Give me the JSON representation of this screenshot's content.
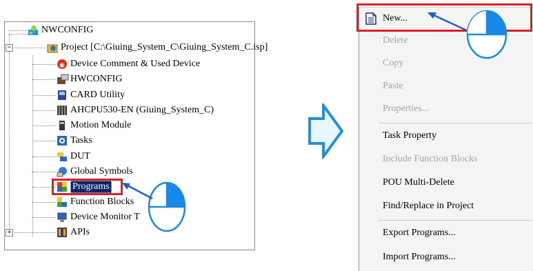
{
  "tree": {
    "items": [
      {
        "label": "NWCONFIG",
        "icon": "nwconfig-icon"
      },
      {
        "label": "Project [C:\\Giuing_System_C\\Giuing_System_C.isp]",
        "icon": "project-icon",
        "expander": "−"
      },
      {
        "label": "Device Comment & Used Device",
        "icon": "device-comment-icon"
      },
      {
        "label": "HWCONFIG",
        "icon": "hwconfig-icon"
      },
      {
        "label": "CARD Utility",
        "icon": "card-utility-icon"
      },
      {
        "label": "AHCPU530-EN  (Giuing_System_C)",
        "icon": "cpu-icon"
      },
      {
        "label": "Motion Module",
        "icon": "motion-module-icon"
      },
      {
        "label": "Tasks",
        "icon": "tasks-icon"
      },
      {
        "label": "DUT",
        "icon": "dut-icon"
      },
      {
        "label": "Global Symbols",
        "icon": "global-symbols-icon"
      },
      {
        "label": "Programs",
        "icon": "programs-icon",
        "selected": true
      },
      {
        "label": "Function Blocks",
        "icon": "function-blocks-icon"
      },
      {
        "label": "Device Monitor T",
        "icon": "device-monitor-icon"
      },
      {
        "label": "APIs",
        "icon": "apis-icon",
        "expander": "+"
      }
    ]
  },
  "context_menu": {
    "items": [
      {
        "label": "New...",
        "enabled": true,
        "icon": "new-document-icon"
      },
      {
        "label": "Delete",
        "enabled": false
      },
      {
        "label": "Copy",
        "enabled": false
      },
      {
        "label": "Paste",
        "enabled": false
      },
      {
        "label": "Properties...",
        "enabled": false
      },
      {
        "label": "Task Property",
        "enabled": true
      },
      {
        "label": "Include Function Blocks",
        "enabled": false
      },
      {
        "label": "POU Multi-Delete",
        "enabled": true
      },
      {
        "label": "Find/Replace in Project",
        "enabled": true
      },
      {
        "label": "Export Programs...",
        "enabled": true
      },
      {
        "label": "Import Programs...",
        "enabled": true
      }
    ]
  },
  "colors": {
    "highlight_red": "#e31b23",
    "arrow_blue": "#1e8ee6",
    "arrow_fill": "#e8f6ff",
    "mouse_blue": "#1a87ea",
    "selection": "#0a246a"
  }
}
